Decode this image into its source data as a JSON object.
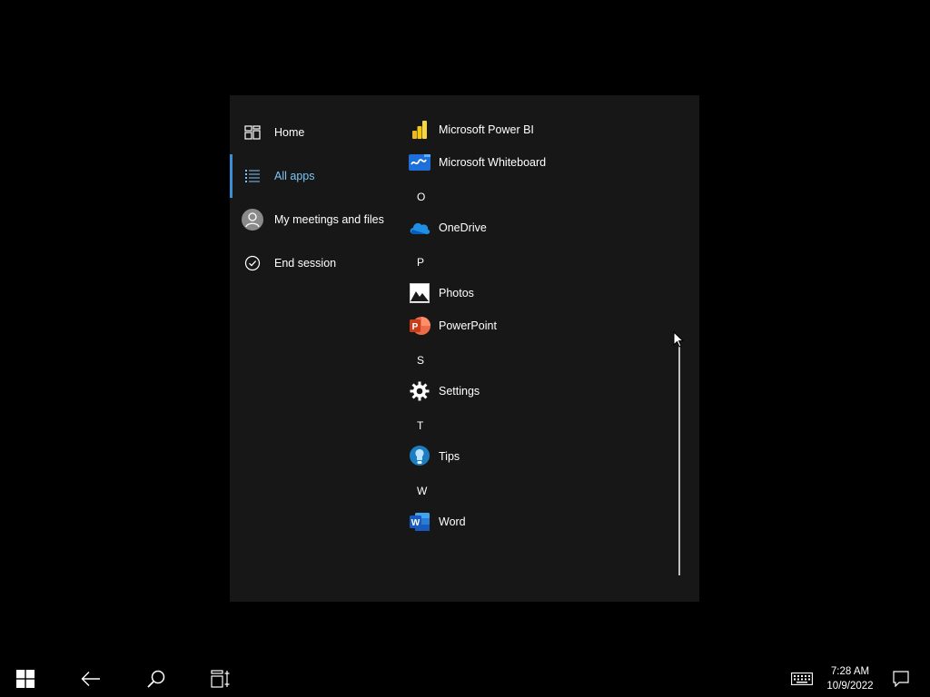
{
  "nav": {
    "items": [
      {
        "label": "Home",
        "icon": "home-grid-icon"
      },
      {
        "label": "All apps",
        "icon": "list-icon",
        "active": true
      },
      {
        "label": "My meetings and files",
        "icon": "avatar-icon"
      },
      {
        "label": "End session",
        "icon": "check-circle-icon"
      }
    ]
  },
  "apps": {
    "power_bi": "Microsoft Power BI",
    "whiteboard": "Microsoft Whiteboard",
    "letter_o": "O",
    "onedrive": "OneDrive",
    "letter_p": "P",
    "photos": "Photos",
    "powerpoint": "PowerPoint",
    "letter_s": "S",
    "settings": "Settings",
    "letter_t": "T",
    "tips": "Tips",
    "letter_w": "W",
    "word": "Word"
  },
  "taskbar": {
    "time": "7:28 AM",
    "date": "10/9/2022"
  },
  "colors": {
    "panel_bg": "#171717",
    "accent": "#3a8ed6",
    "active_text": "#7cc4f5"
  }
}
